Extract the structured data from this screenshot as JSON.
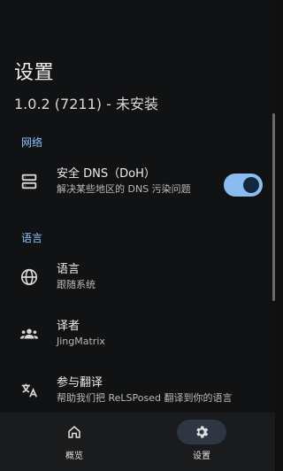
{
  "header": {
    "title": "设置",
    "version": "1.0.2 (7211) - 未安装"
  },
  "sections": {
    "network": "网络",
    "language": "语言"
  },
  "items": {
    "dns": {
      "title": "安全 DNS（DoH）",
      "subtitle": "解决某些地区的 DNS 污染问题",
      "toggle_on": true
    },
    "language": {
      "title": "语言",
      "subtitle": "跟随系统"
    },
    "translators": {
      "title": "译者",
      "subtitle": "JingMatrix"
    },
    "translate": {
      "title": "参与翻译",
      "subtitle": "帮助我们把 ReLSPosed 翻译到你的语言"
    }
  },
  "nav": {
    "overview": "概览",
    "settings": "设置"
  },
  "colors": {
    "accent": "#8ec5ff",
    "switch_track": "#8bbcf1",
    "switch_knob": "#13283f",
    "background": "#111214"
  }
}
